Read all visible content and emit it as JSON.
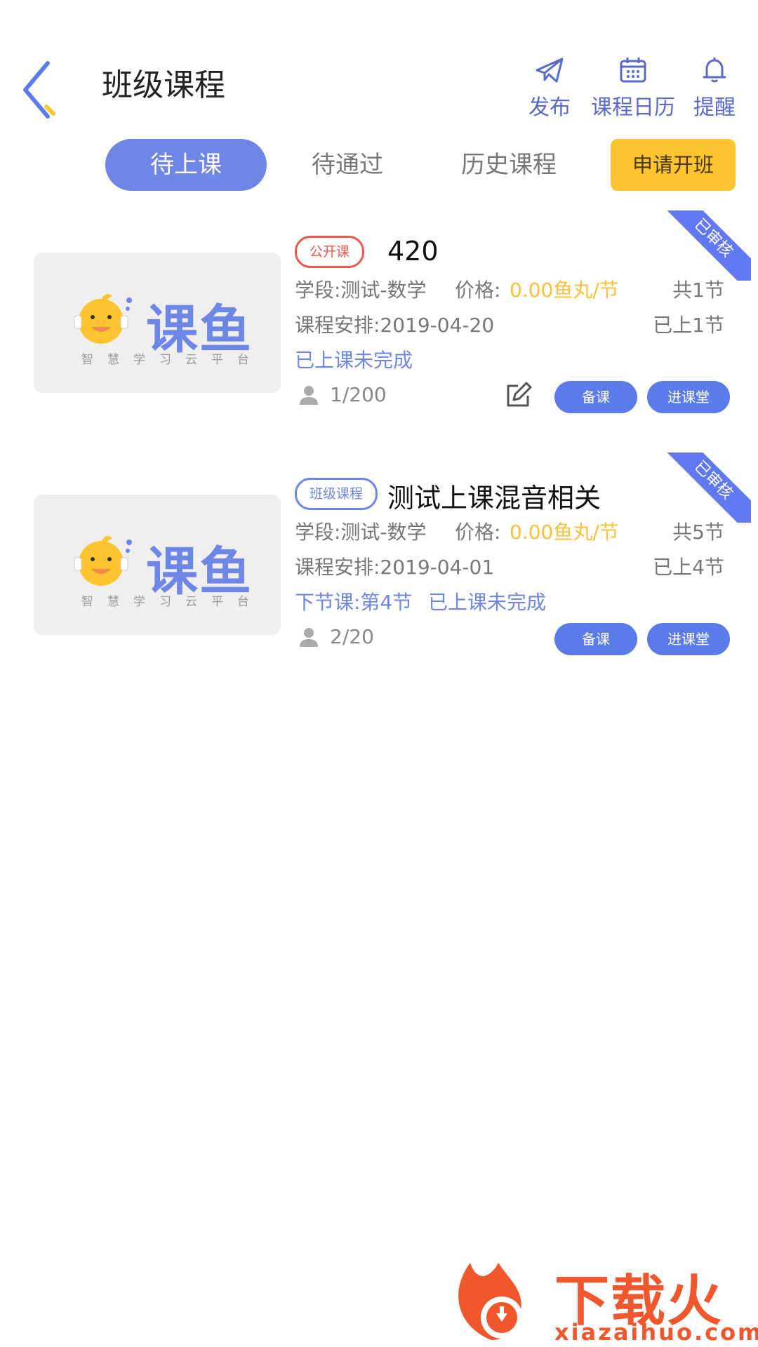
{
  "header": {
    "title": "班级课程",
    "actions": [
      {
        "label": "发布",
        "icon": "paper-plane-icon"
      },
      {
        "label": "课程日历",
        "icon": "calendar-icon"
      },
      {
        "label": "提醒",
        "icon": "bell-icon"
      }
    ]
  },
  "tabs": [
    {
      "label": "待上课",
      "active": true
    },
    {
      "label": "待通过",
      "active": false
    },
    {
      "label": "历史课程",
      "active": false
    }
  ],
  "apply_button": "申请开班",
  "thumbnail": {
    "brand": "课鱼",
    "slogan": "智慧学习云平台"
  },
  "courses": [
    {
      "tag": "公开课",
      "title": "420",
      "ribbon": "已审核",
      "stage": "学段:测试-数学",
      "price_label": "价格:",
      "price": "0.00鱼丸/节",
      "total": "共1节",
      "schedule": "课程安排:2019-04-20",
      "done": "已上1节",
      "status": "已上课未完成",
      "students": "1/200",
      "prep_label": "备课",
      "enter_label": "进课堂"
    },
    {
      "tag": "班级课程",
      "title": "测试上课混音相关",
      "ribbon": "已审核",
      "stage": "学段:测试-数学",
      "price_label": "价格:",
      "price": "0.00鱼丸/节",
      "total": "共5节",
      "schedule": "课程安排:2019-04-01",
      "done": "已上4节",
      "next": "下节课:第4节",
      "status": "已上课未完成",
      "students": "2/20",
      "prep_label": "备课",
      "enter_label": "进课堂"
    }
  ],
  "watermark": {
    "text": "下载火",
    "sub": "xiazaihuo.com"
  },
  "colors": {
    "accent": "#6e86e6",
    "button": "#5a7be9",
    "yellow": "#fec531",
    "price": "#f8c23a",
    "red_tag": "#f0574d"
  }
}
